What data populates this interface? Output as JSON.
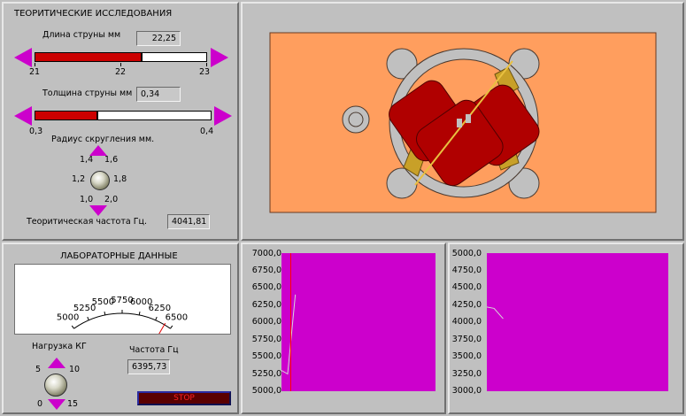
{
  "theory": {
    "title": "ТЕОРИТИЧЕСКИЕ ИССЛЕДОВАНИЯ",
    "string_length": {
      "label": "Длина струны мм",
      "value": "22,25",
      "min_label": "21",
      "mid_label": "22",
      "max_label": "23",
      "fraction": 0.625
    },
    "string_thickness": {
      "label": "Толщина струны мм",
      "value": "0,34",
      "min_label": "0,3",
      "max_label": "0,4",
      "fraction": 0.36
    },
    "radius": {
      "label": "Радиус скругления  мм.",
      "labels": [
        "1,0",
        "1,2",
        "1,4",
        "1,6",
        "1,8",
        "2,0"
      ]
    },
    "freq": {
      "label": "Теоритическая частота  Гц.",
      "value": "4041,81"
    }
  },
  "lab": {
    "title": "ЛАБОРАТОРНЫЕ ДАННЫЕ",
    "gauge": {
      "labels": [
        "5000",
        "5250",
        "5500",
        "5750",
        "6000",
        "6250",
        "6500"
      ],
      "min": 5000,
      "max": 6500,
      "value": 6395.73
    },
    "load": {
      "label": "Нагрузка КГ",
      "labels": [
        "0",
        "5",
        "10",
        "15"
      ]
    },
    "freq": {
      "label": "Частота Гц",
      "value": "6395,73"
    },
    "stop_label": "STOP"
  },
  "colors": {
    "plot_bg": "#cc00cc",
    "accent_red": "#cc0000",
    "arrow": "#cc00cc",
    "device_bg": "#ff9e5e"
  },
  "chart_data": [
    {
      "type": "line",
      "ylim": [
        5000,
        7000
      ],
      "y_ticks": [
        "7000,0",
        "6750,0",
        "6500,0",
        "6250,0",
        "6000,0",
        "5750,0",
        "5500,0",
        "5250,0",
        "5000,0"
      ],
      "series": [
        {
          "values": [
            5300,
            5250,
            6400
          ]
        }
      ],
      "cursor_x": 0.06
    },
    {
      "type": "line",
      "ylim": [
        3000,
        5000
      ],
      "y_ticks": [
        "5000,0",
        "4750,0",
        "4500,0",
        "4250,0",
        "4000,0",
        "3750,0",
        "3500,0",
        "3250,0",
        "3000,0"
      ],
      "series": [
        {
          "values": [
            4220,
            4200,
            4050
          ]
        }
      ]
    }
  ]
}
